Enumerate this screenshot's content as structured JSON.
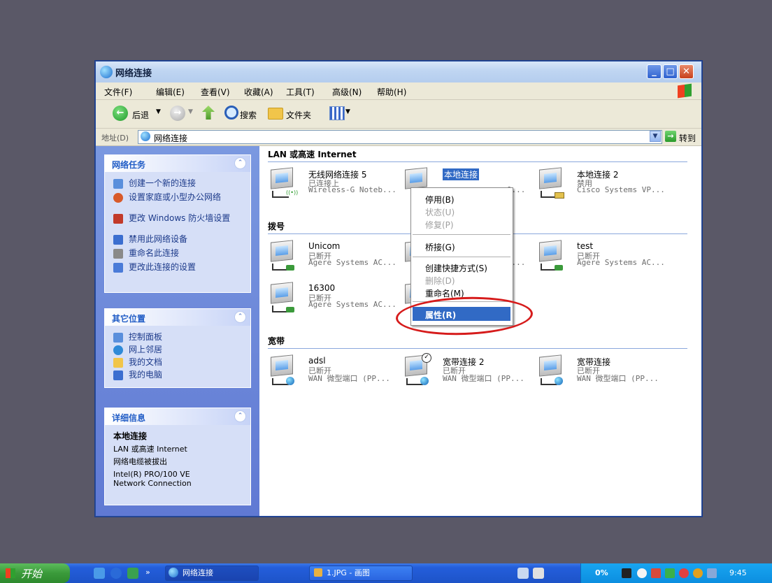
{
  "window": {
    "title": "网络连接",
    "menu": [
      "文件(F)",
      "编辑(E)",
      "查看(V)",
      "收藏(A)",
      "工具(T)",
      "高级(N)",
      "帮助(H)"
    ],
    "toolbar": {
      "back": "后退",
      "search": "搜索",
      "folders": "文件夹"
    },
    "address": {
      "label": "地址(D)",
      "value": "网络连接",
      "go": "转到"
    }
  },
  "left_pane": {
    "network_tasks": {
      "title": "网络任务",
      "items": [
        "创建一个新的连接",
        "设置家庭或小型办公网络",
        "更改 Windows 防火墙设置",
        "禁用此网络设备",
        "重命名此连接",
        "更改此连接的设置"
      ]
    },
    "other_places": {
      "title": "其它位置",
      "items": [
        "控制面板",
        "网上邻居",
        "我的文档",
        "我的电脑"
      ]
    },
    "details": {
      "title": "详细信息",
      "name": "本地连接",
      "lines": [
        "LAN 或高速 Internet",
        "网络电缆被拔出",
        "Intel(R) PRO/100 VE",
        "Network Connection"
      ]
    }
  },
  "groups": [
    {
      "title": "LAN 或高速 Internet",
      "connections": [
        {
          "name": "无线网络连接 5",
          "status": "已连接上",
          "device": "Wireless-G Noteb..."
        },
        {
          "name": "本地连接",
          "status": "",
          "device": "...0..."
        },
        {
          "name": "本地连接 2",
          "status": "禁用",
          "device": "Cisco Systems VP..."
        }
      ]
    },
    {
      "title": "拨号",
      "connections": [
        {
          "name": "Unicom",
          "status": "已断开",
          "device": "Agere Systems AC..."
        },
        {
          "name": "",
          "status": "",
          "device": "...C..."
        },
        {
          "name": "test",
          "status": "已断开",
          "device": "Agere Systems AC..."
        },
        {
          "name": "16300",
          "status": "已断开",
          "device": "Agere Systems AC..."
        }
      ]
    },
    {
      "title": "宽带",
      "connections": [
        {
          "name": "adsl",
          "status": "已断开",
          "device": "WAN 微型端口 (PP..."
        },
        {
          "name": "宽带连接 2",
          "status": "已断开",
          "device": "WAN 微型端口 (PP..."
        },
        {
          "name": "宽带连接",
          "status": "已断开",
          "device": "WAN 微型端口 (PP..."
        }
      ]
    }
  ],
  "context_menu": {
    "items": [
      {
        "label": "停用(B)",
        "disabled": false
      },
      {
        "label": "状态(U)",
        "disabled": true
      },
      {
        "label": "修复(P)",
        "disabled": true
      },
      {
        "label": "桥接(G)",
        "disabled": false
      },
      {
        "label": "创建快捷方式(S)",
        "disabled": false
      },
      {
        "label": "删除(D)",
        "disabled": true
      },
      {
        "label": "重命名(M)",
        "disabled": false
      },
      {
        "label": "属性(R)",
        "disabled": false,
        "highlighted": true
      }
    ]
  },
  "taskbar": {
    "start": "开始",
    "buttons": [
      "网络连接",
      "1.JPG - 画图"
    ],
    "tray": {
      "percent": "0%",
      "clock": "9:45"
    }
  },
  "colors": {
    "highlight": "#316ac5",
    "annotation": "#d61b1b",
    "task_pane": "#6079d3"
  }
}
